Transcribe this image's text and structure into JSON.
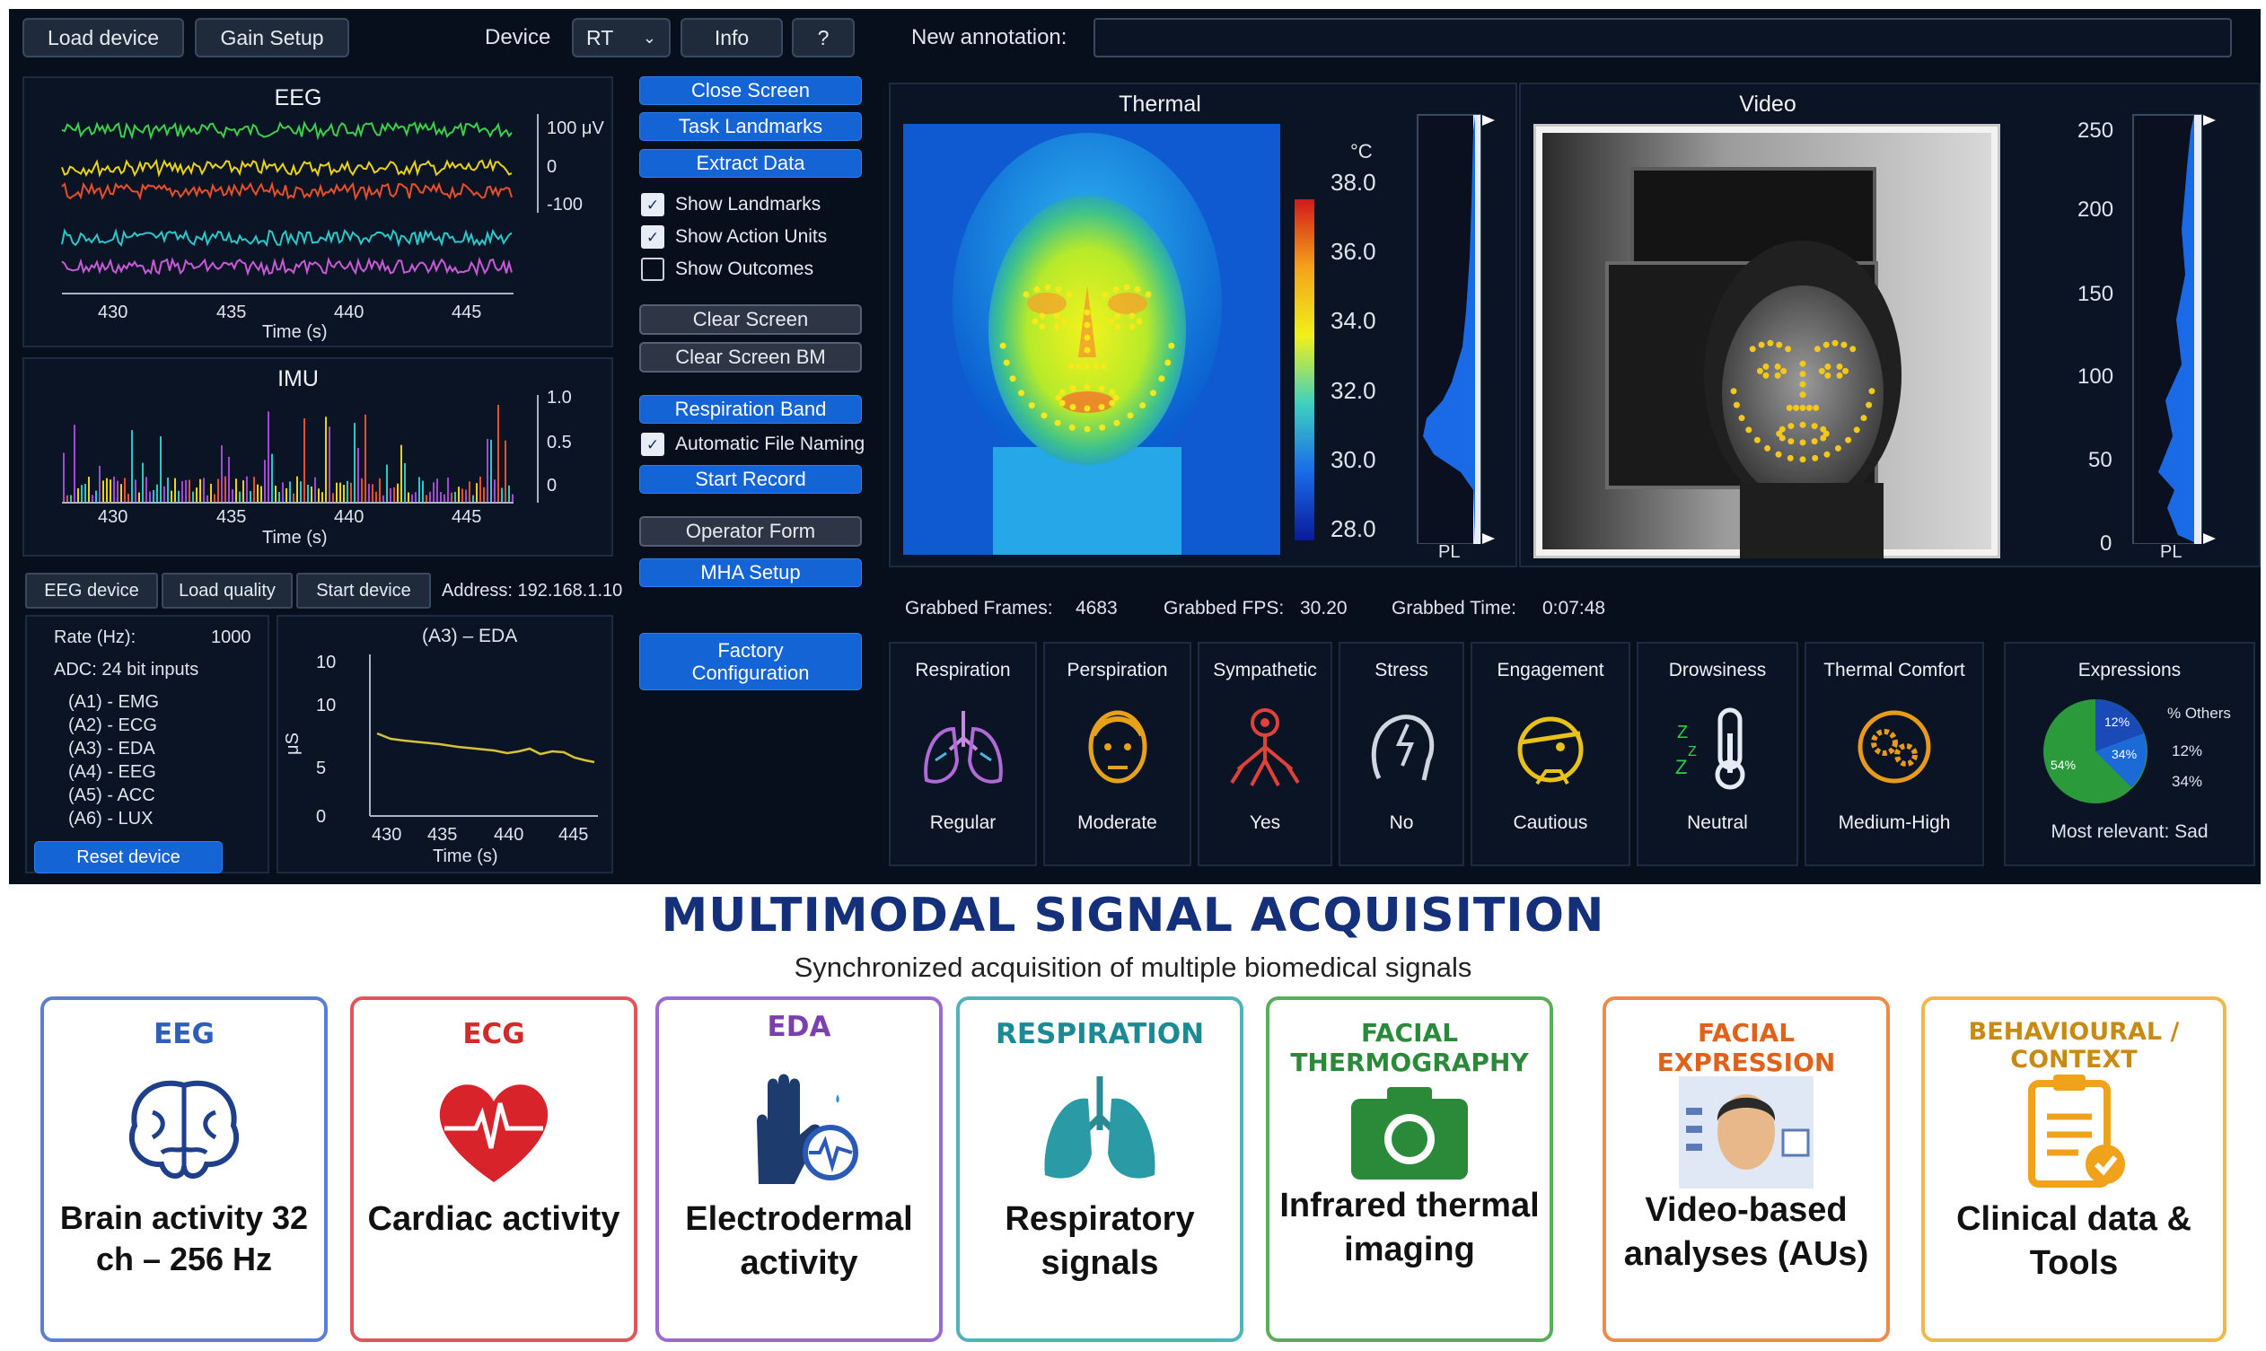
{
  "toolbar": {
    "load_device": "Load device",
    "gain_setup": "Gain Setup",
    "device_label": "Device",
    "device_value": "RT",
    "info": "Info",
    "help": "?"
  },
  "annotation": {
    "label": "New annotation:",
    "value": ""
  },
  "eeg_chart": {
    "title": "EEG",
    "xlabel": "Time (s)",
    "xticks": [
      "430",
      "435",
      "440",
      "445"
    ],
    "yticks": [
      "100 μV",
      "0",
      "-100"
    ]
  },
  "imu_chart": {
    "title": "IMU",
    "xlabel": "Time (s)",
    "xticks": [
      "430",
      "435",
      "440",
      "445"
    ],
    "yticks": [
      "1.0",
      "0.5",
      "0"
    ]
  },
  "controls": {
    "close_screen": "Close Screen",
    "task_landmarks": "Task Landmarks",
    "extract_data": "Extract Data",
    "show_landmarks": "Show Landmarks",
    "show_action_units": "Show Action Units",
    "show_outcomes": "Show Outcomes",
    "clear_screen": "Clear Screen",
    "clear_screen_bm": "Clear Screen BM",
    "respiration_band": "Respiration Band",
    "automatic_file_naming": "Automatic File Naming",
    "start_record": "Start Record",
    "operator_form": "Operator Form",
    "mha_setup": "MHA Setup",
    "factory_configuration": "Factory Configuration"
  },
  "device_tabs": {
    "eeg_device": "EEG device",
    "load_quality": "Load quality",
    "start_device": "Start device",
    "address": "Address: 192.168.1.10"
  },
  "device_info": {
    "rate_label": "Rate (Hz):",
    "rate_value": "1000",
    "adc": "ADC: 24 bit inputs",
    "channels": [
      "(A1) - EMG",
      "(A2) - ECG",
      "(A3) - EDA",
      "(A4) - EEG",
      "(A5) - ACC",
      "(A6) - LUX"
    ],
    "reset": "Reset device"
  },
  "eda_chart": {
    "title": "(A3) – EDA",
    "xlabel": "Time (s)",
    "ylabel": "μS",
    "xticks": [
      "430",
      "435",
      "440",
      "445"
    ],
    "yticks": [
      "10",
      "10",
      "5",
      "0"
    ]
  },
  "thermal": {
    "title": "Thermal",
    "unit": "°C",
    "scale": [
      "38.0",
      "36.0",
      "34.0",
      "32.0",
      "30.0",
      "28.0"
    ],
    "pl": "PL"
  },
  "video": {
    "title": "Video",
    "scale": [
      "250",
      "200",
      "150",
      "100",
      "50",
      "0"
    ],
    "pl": "PL"
  },
  "stats": {
    "frames_label": "Grabbed Frames:",
    "frames": "4683",
    "fps_label": "Grabbed FPS:",
    "fps": "30.20",
    "time_label": "Grabbed Time:",
    "time": "0:07:48"
  },
  "states": [
    {
      "name": "Respiration",
      "value": "Regular"
    },
    {
      "name": "Perspiration",
      "value": "Moderate"
    },
    {
      "name": "Sympathetic",
      "value": "Yes"
    },
    {
      "name": "Stress",
      "value": "No"
    },
    {
      "name": "Engagement",
      "value": "Cautious"
    },
    {
      "name": "Drowsiness",
      "value": "Neutral"
    },
    {
      "name": "Thermal Comfort",
      "value": "Medium-High"
    }
  ],
  "expressions": {
    "title": "Expressions",
    "slice_labels": [
      "12%",
      "34%",
      "54%"
    ],
    "legend": [
      "% Others",
      "12%",
      "34%"
    ],
    "most_relevant": "Most relevant: Sad"
  },
  "infographic": {
    "title": "MULTIMODAL SIGNAL ACQUISITION",
    "subtitle": "Synchronized acquisition of multiple biomedical signals",
    "cards": [
      {
        "head": "EEG",
        "text": "Brain activity 32 ch – 256 Hz",
        "color": "#2f5fb6"
      },
      {
        "head": "ECG",
        "text": "Cardiac activity",
        "color": "#d22a2a"
      },
      {
        "head": "EDA",
        "text": "Electrodermal activity",
        "color": "#7b3fb0"
      },
      {
        "head": "RESPIRATION",
        "text": "Respiratory signals",
        "color": "#1a8a94"
      },
      {
        "head": "FACIAL THERMOGRAPHY",
        "text": "Infrared thermal imaging",
        "color": "#2a8a3a"
      },
      {
        "head": "FACIAL EXPRESSION",
        "text": "Video-based analyses (AUs)",
        "color": "#e0621a"
      },
      {
        "head": "BEHAVIOURAL / CONTEXT",
        "text": "Clinical data & Tools",
        "color": "#c98a12"
      }
    ]
  },
  "colors": {
    "app_bg": "#080f1c",
    "accent_blue": "#1464d6"
  }
}
